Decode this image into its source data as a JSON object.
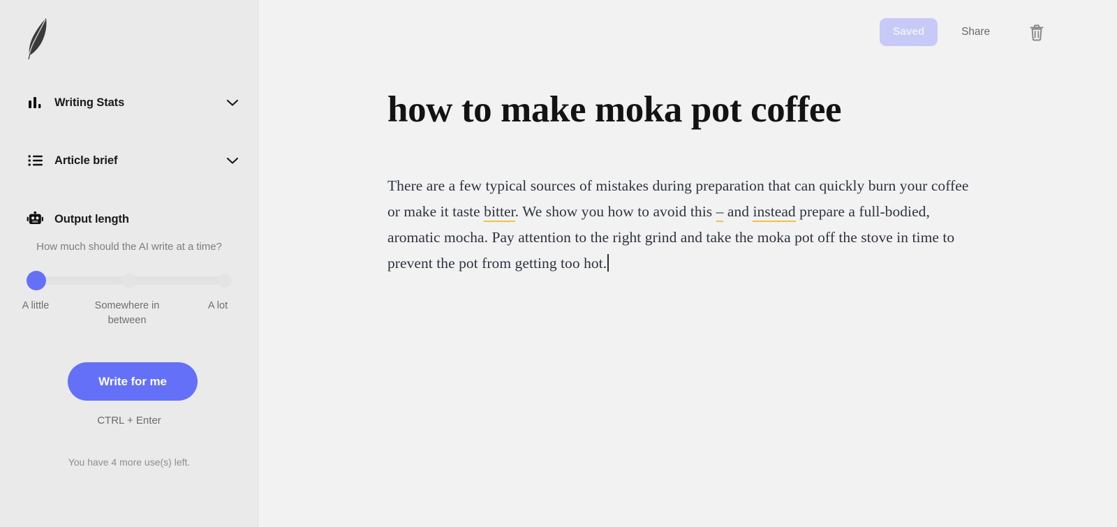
{
  "sidebar": {
    "logo_name": "feather-quill-logo",
    "nav": [
      {
        "id": "writing-stats",
        "label": "Writing Stats",
        "icon": "bar-chart-icon",
        "expandable": true
      },
      {
        "id": "article-brief",
        "label": "Article brief",
        "icon": "list-icon",
        "expandable": true
      },
      {
        "id": "output-length",
        "label": "Output length",
        "icon": "robot-icon",
        "expandable": false
      }
    ],
    "output_length": {
      "question": "How much should the AI write at a time?",
      "slider_value": 0,
      "slider_min": 0,
      "slider_max": 2,
      "labels": {
        "left": "A little",
        "middle": "Somewhere in between",
        "right": "A lot"
      }
    },
    "write_button": "Write for me",
    "shortcut_hint": "CTRL + Enter",
    "uses_left": "You have 4 more use(s) left."
  },
  "topbar": {
    "saved_label": "Saved",
    "share_label": "Share",
    "delete_icon": "trash-icon"
  },
  "document": {
    "title": "how to make moka pot coffee",
    "paragraph": [
      {
        "text": "There are a few typical sources of mistakes during preparation that can quickly burn your coffee or make it taste ",
        "suggestion": false
      },
      {
        "text": "bitter",
        "suggestion": true
      },
      {
        "text": ". We show you how to avoid this ",
        "suggestion": false
      },
      {
        "text": "–",
        "suggestion": true
      },
      {
        "text": " and ",
        "suggestion": false
      },
      {
        "text": "instead",
        "suggestion": true
      },
      {
        "text": " prepare a full-bodied, aromatic mocha. Pay attention to the right grind and take the moka pot off the stove in time to prevent the pot from getting too hot.",
        "suggestion": false
      }
    ],
    "caret_visible": true
  },
  "grammarly": {
    "suggestion_count": "3",
    "bulb_icon": "lightbulb-icon",
    "logo_icon": "grammarly-g-icon"
  },
  "colors": {
    "accent": "#6370f7",
    "saved_badge_bg": "#c7c9f7",
    "suggestion_underline": "#f3c23f",
    "grammarly_green": "#0a6e55",
    "grammarly_teal": "#0fa37f",
    "badge_amber": "#e8a33d",
    "sidebar_bg": "#eaeaea",
    "main_bg": "#f2f2f2"
  }
}
